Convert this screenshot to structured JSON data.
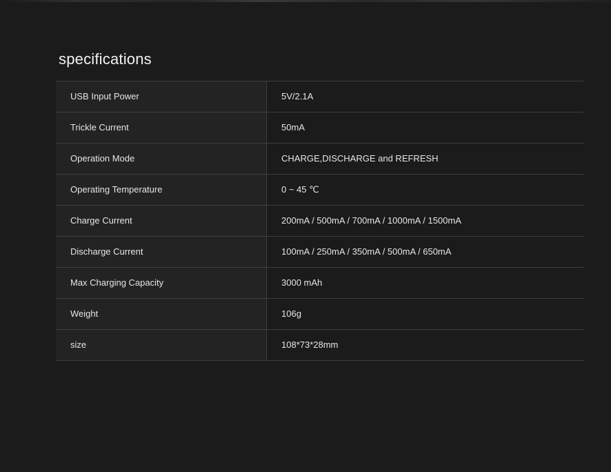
{
  "page": {
    "title": "specifications"
  },
  "specs": [
    {
      "label": "USB Input Power",
      "value": "5V/2.1A"
    },
    {
      "label": "Trickle Current",
      "value": "50mA"
    },
    {
      "label": "Operation Mode",
      "value": "CHARGE,DISCHARGE and REFRESH"
    },
    {
      "label": "Operating Temperature",
      "value": "0 ~ 45 ℃"
    },
    {
      "label": "Charge Current",
      "value": "200mA / 500mA / 700mA / 1000mA / 1500mA"
    },
    {
      "label": "Discharge Current",
      "value": "100mA / 250mA / 350mA / 500mA / 650mA"
    },
    {
      "label": "Max Charging Capacity",
      "value": "3000 mAh"
    },
    {
      "label": "Weight",
      "value": "106g"
    },
    {
      "label": "size",
      "value": "108*73*28mm"
    }
  ]
}
